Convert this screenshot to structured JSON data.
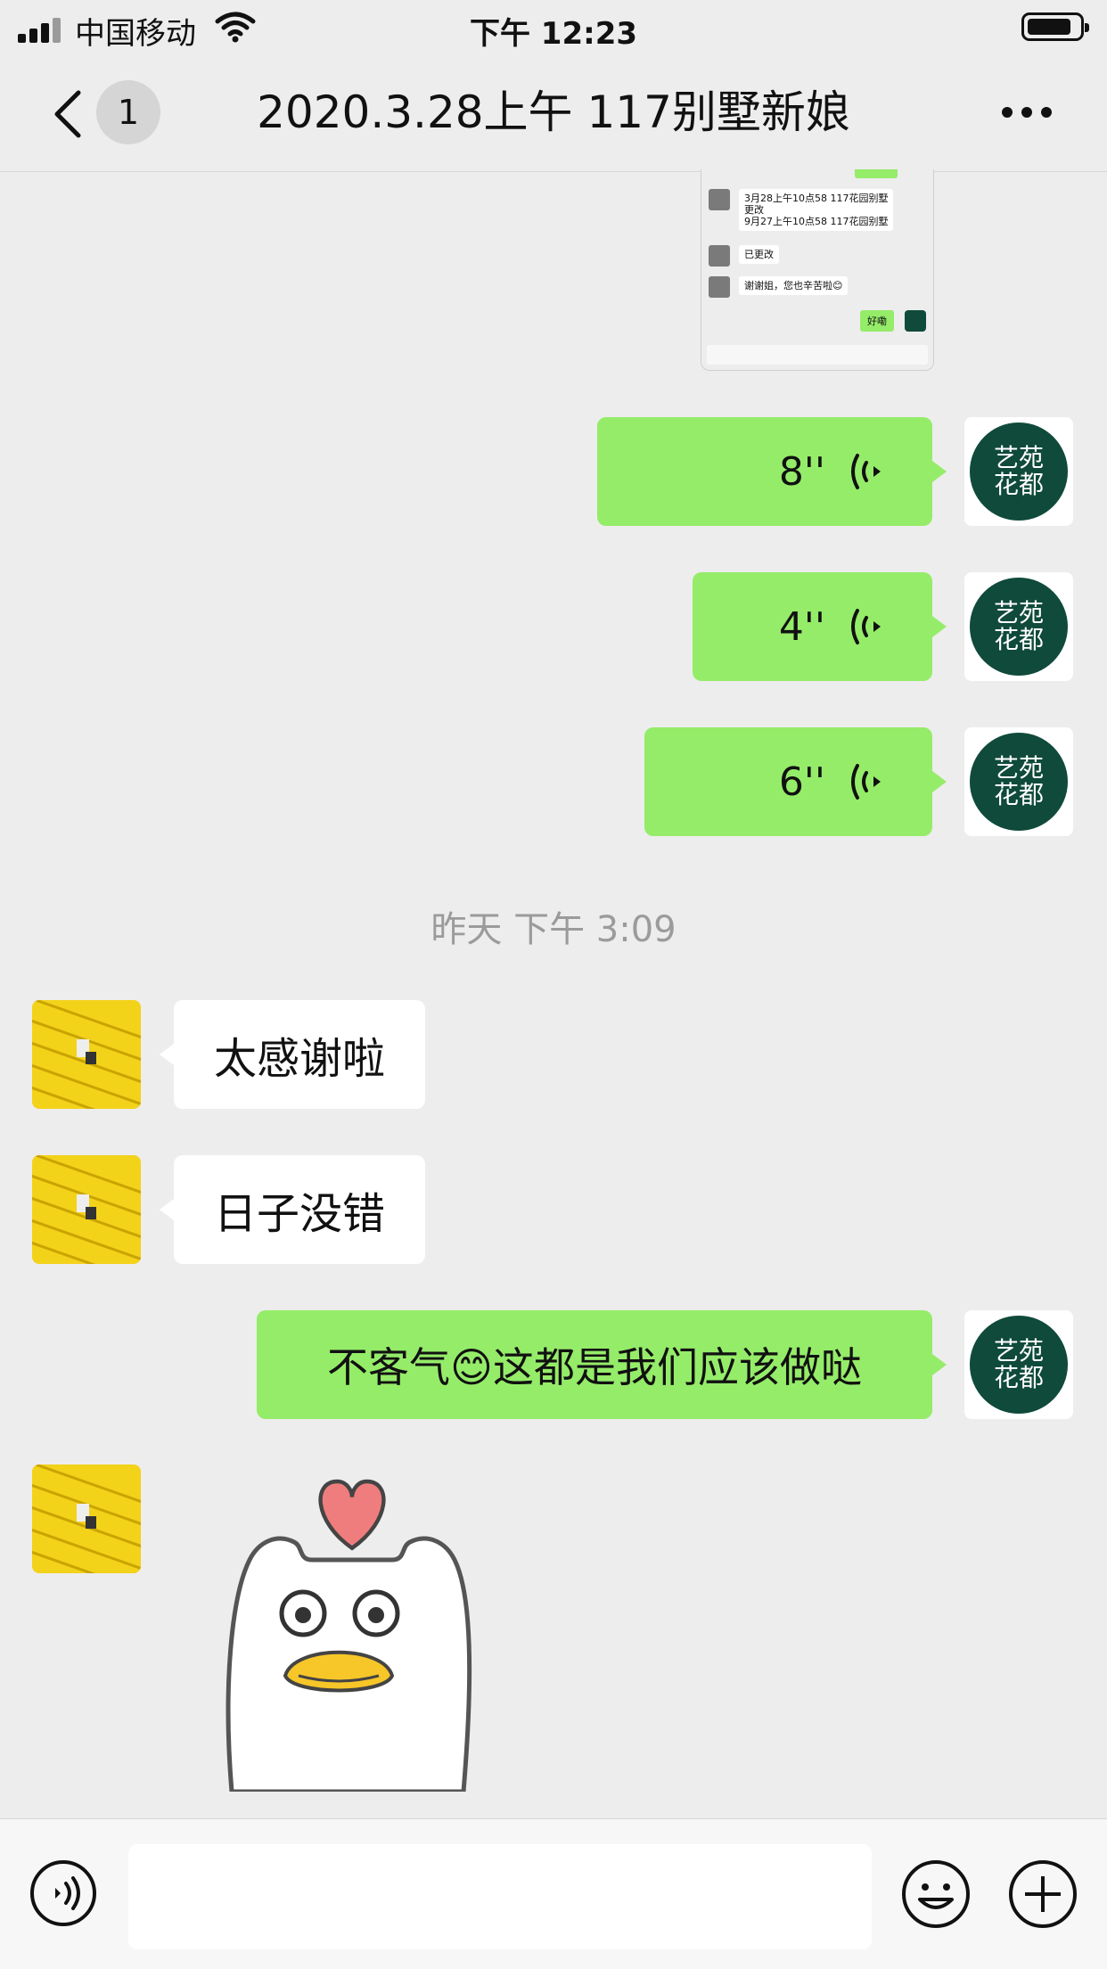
{
  "status": {
    "carrier": "中国移动",
    "time": "下午 12:23",
    "battery_level": 0.85
  },
  "nav": {
    "unread_count": "1",
    "title": "2020.3.28上午 117别墅新娘"
  },
  "embedded_screenshot": {
    "messages": [
      {
        "text": "3月28上午10点58 117花园别墅\n更改\n9月27上午10点58 117花园别墅"
      },
      {
        "text": "已更改"
      },
      {
        "text": "谢谢姐，您也辛苦啦😊"
      }
    ],
    "own_reply": "好嘞"
  },
  "voice_messages": [
    {
      "duration": "8''"
    },
    {
      "duration": "4''"
    },
    {
      "duration": "6''"
    }
  ],
  "logo_text": {
    "line1": "艺苑",
    "line2": "花都",
    "mark": "®"
  },
  "timestamp": "昨天 下午 3:09",
  "incoming": [
    {
      "text": "太感谢啦"
    },
    {
      "text": "日子没错"
    }
  ],
  "outgoing_text": "不客气😊这都是我们应该做哒",
  "input": {
    "placeholder": ""
  },
  "colors": {
    "background": "#ededed",
    "bubble_green": "#95ec69",
    "logo_green": "#0f4a3a",
    "timestamp_gray": "#9b9b9b"
  }
}
